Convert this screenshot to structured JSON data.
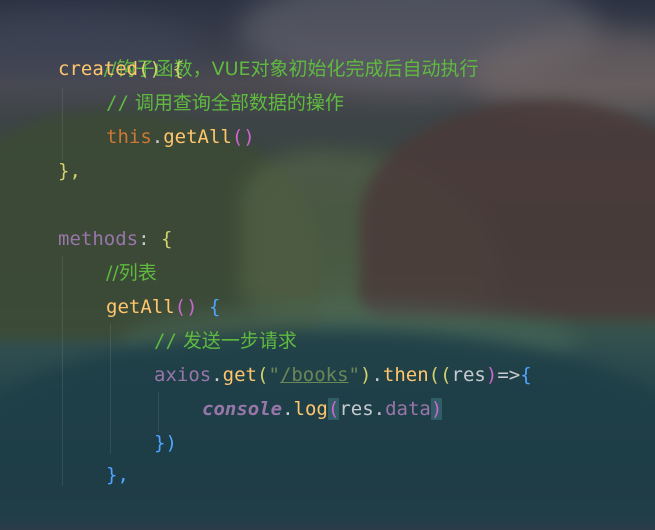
{
  "code": {
    "l1_comment": "//钩子函数，VUE对象初始化完成后自动执行",
    "l2_created": "created",
    "l2_paren": "()",
    "l2_brace": " {",
    "l3_slashes": "//",
    "l3_text": " 调用查询全部数据的操作",
    "l4_this": "this",
    "l4_dot": ".",
    "l4_method": "getAll",
    "l4_paren": "()",
    "l5_close": "},",
    "l7_methods": "methods",
    "l7_colon": ": ",
    "l7_brace": "{",
    "l8_comment": "//列表",
    "l9_method": "getAll",
    "l9_paren": "()",
    "l9_brace": " {",
    "l10_slashes": "//",
    "l10_text": " 发送一步请求",
    "l11_axios": "axios",
    "l11_dot": ".",
    "l11_get": "get",
    "l11_open": "(",
    "l11_q1": "\"",
    "l11_url": "/books",
    "l11_q2": "\"",
    "l11_close": ")",
    "l11_dot2": ".",
    "l11_then": "then",
    "l11_open2": "((",
    "l11_res": "res",
    "l11_close2": ")",
    "l11_arrow": "=>",
    "l11_brace": "{",
    "l12_console": "console",
    "l12_dot": ".",
    "l12_log": "log",
    "l12_open": "(",
    "l12_res": "res",
    "l12_dot2": ".",
    "l12_data": "data",
    "l12_close": ")",
    "l13_close": "})",
    "l14_close": "},"
  },
  "colors": {
    "comment": "#5fba3f",
    "keyword": "#cc7832",
    "function": "#ffc66d",
    "property": "#9876aa",
    "string": "#6a8759"
  }
}
